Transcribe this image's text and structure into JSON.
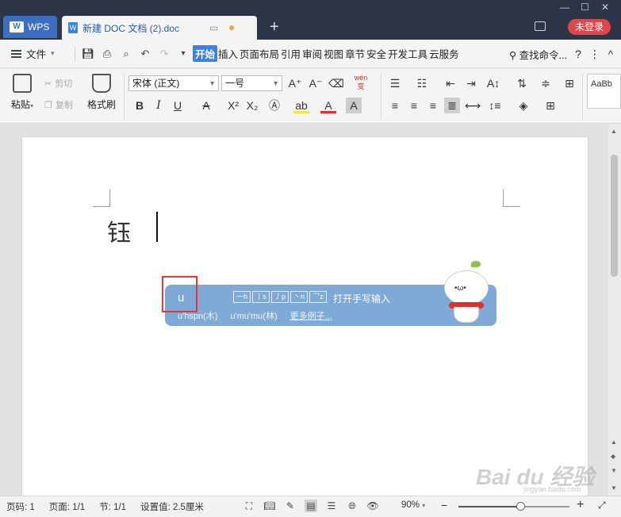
{
  "titlebar": {
    "app_tab": "WPS",
    "doc_tab": "新建 DOC 文档 (2).doc",
    "new_tab_symbol": "+",
    "login_button": "未登录"
  },
  "menubar": {
    "file_menu": "文件",
    "items": [
      "开始",
      "插入",
      "页面布局",
      "引用",
      "审阅",
      "视图",
      "章节",
      "安全",
      "开发工具",
      "云服务"
    ],
    "active_item": "开始",
    "search_label": "查找命令...",
    "help": "?",
    "more": "⋮",
    "collapse": "^"
  },
  "ribbon": {
    "paste": "粘贴",
    "cut": "剪切",
    "copy": "复制",
    "format_painter": "格式刷",
    "font_name": "宋体 (正文)",
    "font_size": "一号",
    "pinyin_glyph": "wén 变",
    "style_preview": "AaBb"
  },
  "document": {
    "text": "钰",
    "ime": {
      "input": "u",
      "strokes": [
        "一h",
        "丨s",
        "丿p",
        "丶n",
        "乛z"
      ],
      "handwrite": "打开手写输入",
      "examples": [
        "u'hspn(木)",
        "u'mu'mu(林)"
      ],
      "more_examples": "更多例子..."
    }
  },
  "watermark": {
    "text": "Bai du 经验",
    "sub": "jingyan.baidu.com"
  },
  "statusbar": {
    "page_num": "页码: 1",
    "pages": "页面: 1/1",
    "section": "节: 1/1",
    "setting": "设置值: 2.5厘米",
    "zoom": "90%",
    "zoom_level": 0.56
  },
  "colors": {
    "titlebar_bg": "#2d3548",
    "accent": "#3c82e6",
    "login_bg": "#e0474b",
    "ime_bg": "#7fa9d6",
    "highlight_box": "#e03a3a"
  }
}
